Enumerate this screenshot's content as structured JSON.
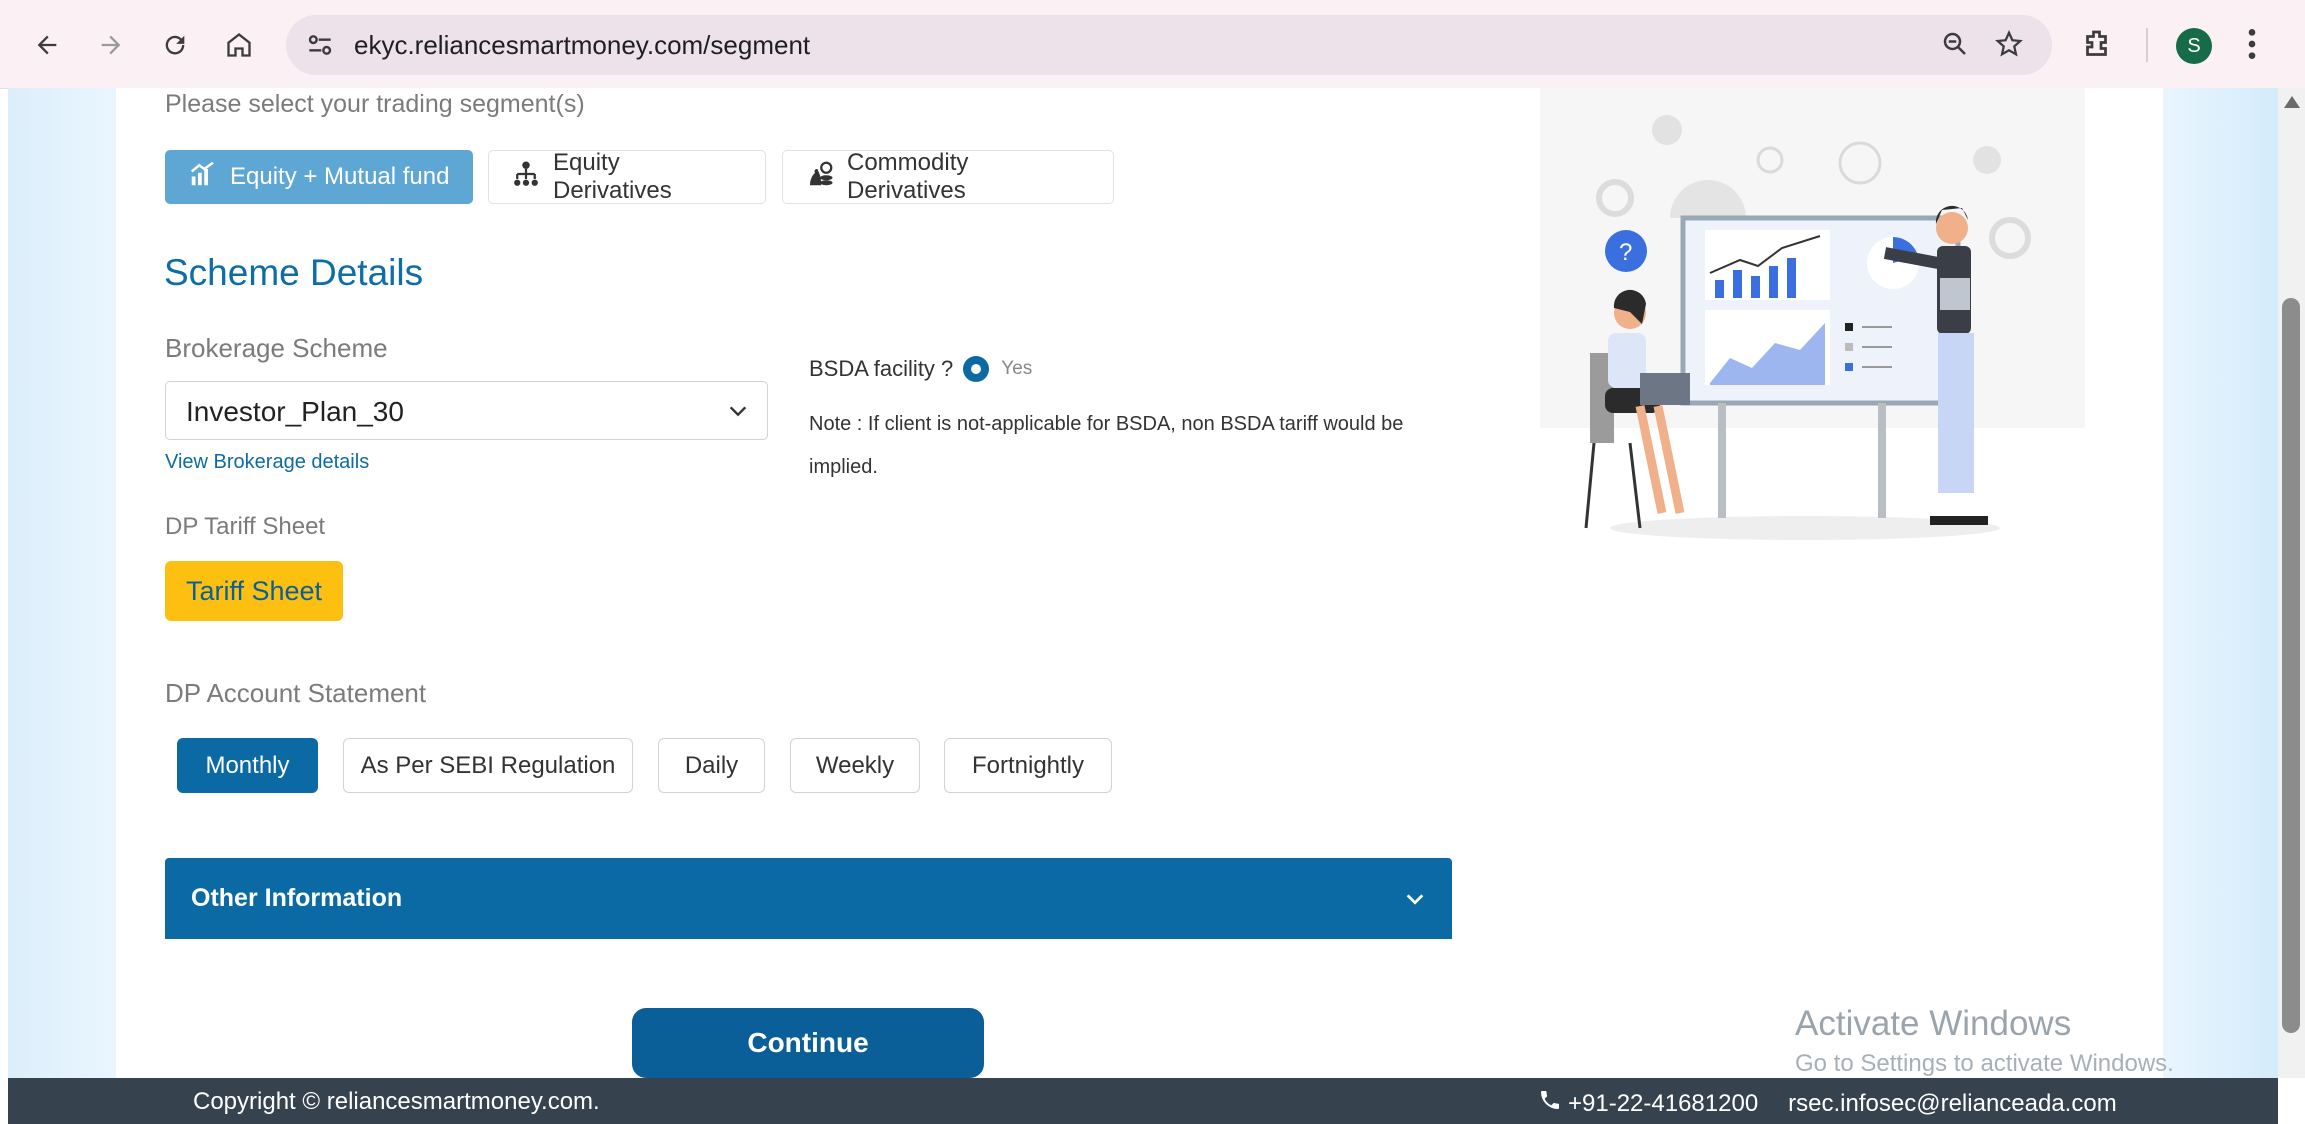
{
  "browser": {
    "url": "ekyc.reliancesmartmoney.com/segment",
    "profile_initial": "S"
  },
  "segment": {
    "prompt": "Please select your trading segment(s)",
    "options": [
      {
        "label": "Equity + Mutual fund",
        "selected": true
      },
      {
        "label": "Equity Derivatives",
        "selected": false
      },
      {
        "label": "Commodity Derivatives",
        "selected": false
      }
    ]
  },
  "scheme": {
    "heading": "Scheme Details",
    "brokerage_label": "Brokerage Scheme",
    "brokerage_value": "Investor_Plan_30",
    "brokerage_link": "View Brokerage details",
    "bsda_label": "BSDA facility ?",
    "bsda_option": "Yes",
    "bsda_note": "Note : If client is not-applicable for BSDA, non BSDA tariff would be implied.",
    "dp_tariff_label": "DP Tariff Sheet",
    "tariff_button": "Tariff Sheet"
  },
  "statement": {
    "label": "DP Account Statement",
    "options": [
      {
        "label": "Monthly",
        "selected": true
      },
      {
        "label": "As Per SEBI Regulation",
        "selected": false
      },
      {
        "label": "Daily",
        "selected": false
      },
      {
        "label": "Weekly",
        "selected": false
      },
      {
        "label": "Fortnightly",
        "selected": false
      }
    ]
  },
  "other_info": {
    "title": "Other Information"
  },
  "continue_label": "Continue",
  "watermark": {
    "line1": "Activate Windows",
    "line2": "Go to Settings to activate Windows."
  },
  "footer": {
    "copyright": "Copyright © reliancesmartmoney.com.",
    "phone": "+91-22-41681200",
    "email": "rsec.infosec@relianceada.com"
  },
  "colors": {
    "primary": "#0b6aa3",
    "segment_active": "#5ea6d3",
    "tariff": "#fdc010",
    "footer": "#37424f"
  }
}
